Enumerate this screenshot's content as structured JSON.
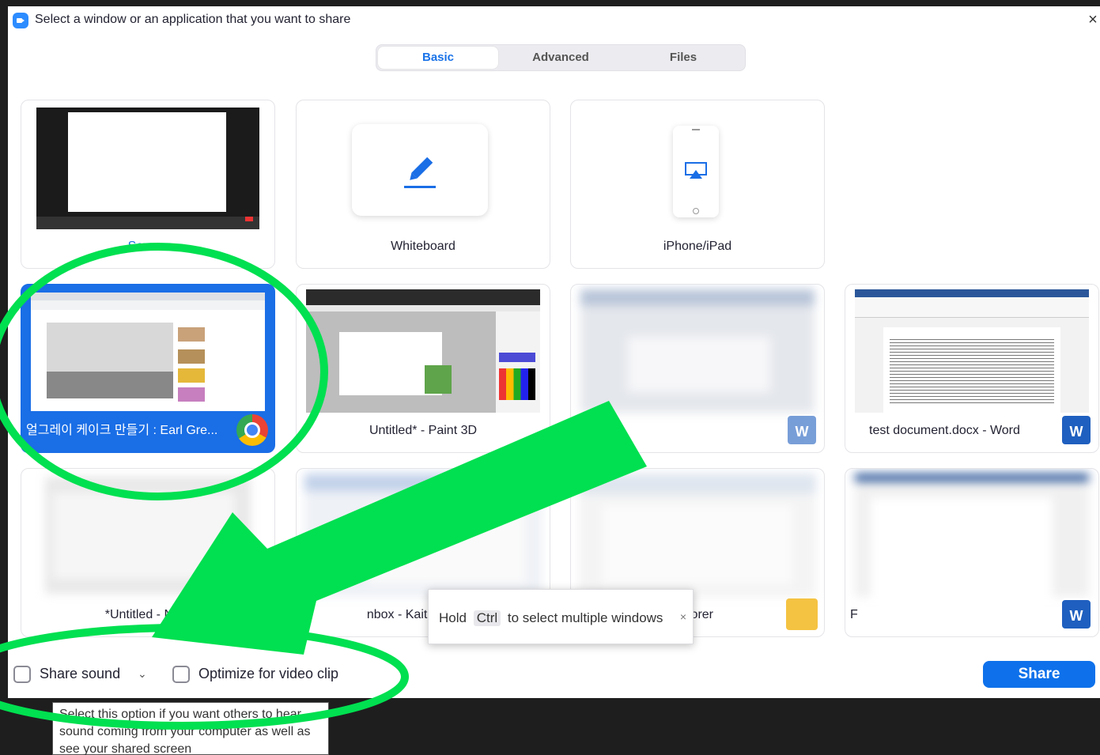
{
  "titlebar": {
    "title": "Select a window or an application that you want to share",
    "close": "×"
  },
  "tabs": [
    {
      "label": "Basic",
      "active": true
    },
    {
      "label": "Advanced",
      "active": false
    },
    {
      "label": "Files",
      "active": false
    }
  ],
  "cards": {
    "screen": {
      "label": "Screen"
    },
    "whiteboard": {
      "label": "Whiteboard"
    },
    "iphone": {
      "label": "iPhone/iPad"
    },
    "chrome": {
      "label": "얼그레이 케이크 만들기 : Earl Gre..."
    },
    "paint3d": {
      "label": "Untitled* - Paint 3D"
    },
    "blurred_word": {
      "label": ""
    },
    "test_doc": {
      "label": "test document.docx - Word"
    },
    "notepad": {
      "label": "*Untitled - Note"
    },
    "inbox": {
      "label": "nbox - Kaitlyn.Sudol"
    },
    "explorer": {
      "label": "orer"
    },
    "word2": {
      "label": "F"
    }
  },
  "bottom": {
    "share_sound": "Share sound",
    "chevron": "⌄",
    "optimize": "Optimize for video clip",
    "share_button": "Share"
  },
  "ctrl_tooltip": {
    "before": "Hold",
    "key": "Ctrl",
    "after": "to select multiple windows",
    "close": "×"
  },
  "sound_tooltip": {
    "text": "Select this option if you want others to hear sound coming from your computer as well as see your shared screen"
  },
  "colors": {
    "accent": "#0e71eb",
    "selected_card": "#1a6ee6",
    "annotation_green": "#00e050"
  }
}
